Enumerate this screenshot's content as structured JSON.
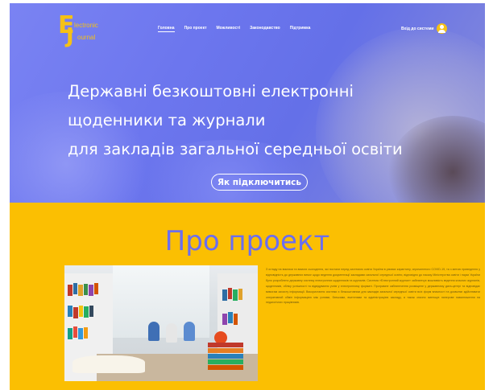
{
  "logo": {
    "letter_e": "E",
    "letter_j": "J",
    "line1": "lectronic",
    "line2": "ournal"
  },
  "nav": {
    "items": [
      {
        "label": "Головна",
        "active": true
      },
      {
        "label": "Про проект",
        "active": false
      },
      {
        "label": "Можливості",
        "active": false
      },
      {
        "label": "Законодавство",
        "active": false
      },
      {
        "label": "Підтримка",
        "active": false
      }
    ],
    "login_label": "Вхід до системи"
  },
  "hero": {
    "headline_lines": [
      "Державні безкоштовні електронні",
      "щоденники та журнали",
      "для закладів загальної середньої освіти"
    ],
    "cta_label": "Як підключитись"
  },
  "about": {
    "title": "Про проект",
    "text": "З огляду на виклики та вимоги сьогодення, які постали перед системою освіти України в умовах карантину, спричиненого COVID-19, та з метою приведення у відповідність до державних вимог щодо ведення документації закладами загальної середньої освіти, відповідно до наказу Міністерства освіти і науки України було розроблено державну систему електронних щоденників та журналів. Система «Електронний журнал» забезпечує можливість ведення класних журналів, щоденників, обліку успішності та відвідування учнів у електронному форматі. Програмне забезпечення розміщене у державному дата-центрі та відповідає вимогам захисту інформації. Використання системи є безкоштовним для закладів загальної середньої освіти всіх форм власності та дозволяє здійснювати оперативний обмін інформацією між учнями, батьками, вчителями та адміністрацією закладу, а також значно зменшує паперове навантаження на педагогічних працівників."
  },
  "colors": {
    "hero_blue": "#6c76ee",
    "accent_yellow": "#fbbf02",
    "title_purple": "#6b6ef0"
  }
}
